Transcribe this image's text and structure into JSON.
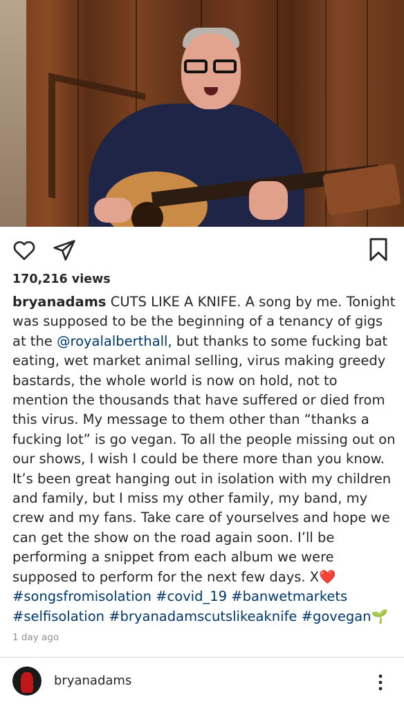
{
  "post": {
    "views": "170,216 views",
    "username": "bryanadams",
    "caption_parts": {
      "p1": " CUTS LIKE A KNIFE. A song by me. Tonight was supposed to be the beginning of a tenancy of gigs at the ",
      "mention": "@royalalberthall",
      "p2": ", but thanks to some fucking bat eating, wet market animal selling, virus making greedy bastards, the whole world is now on hold, not to mention the thousands that have suffered or died from this virus. My message to them other than “thanks a fucking lot” is go vegan. To all the people missing out on our shows, I wish I could be there more than you know. It’s been great hanging out in isolation with my children and family, but I miss my other family, my band, my crew and my fans. Take care of yourselves and hope we can get the show on the road again soon. I’ll be performing a snippet from each album we were supposed to perform for the next few days. X❤️ ",
      "hashtags": [
        "#songsfromisolation",
        "#covid_19",
        "#banwetmarkets",
        "#selfisolation",
        "#bryanadamscutslikeaknife",
        "#govegan"
      ],
      "tail": "🌱"
    },
    "timestamp": "1 day ago"
  },
  "author": {
    "name": "bryanadams"
  },
  "icons": {
    "like": "heart-icon",
    "share": "send-icon",
    "save": "bookmark-icon",
    "more": "more-icon"
  },
  "colors": {
    "text": "#262626",
    "link": "#00376b",
    "muted": "#8e8e8e"
  }
}
